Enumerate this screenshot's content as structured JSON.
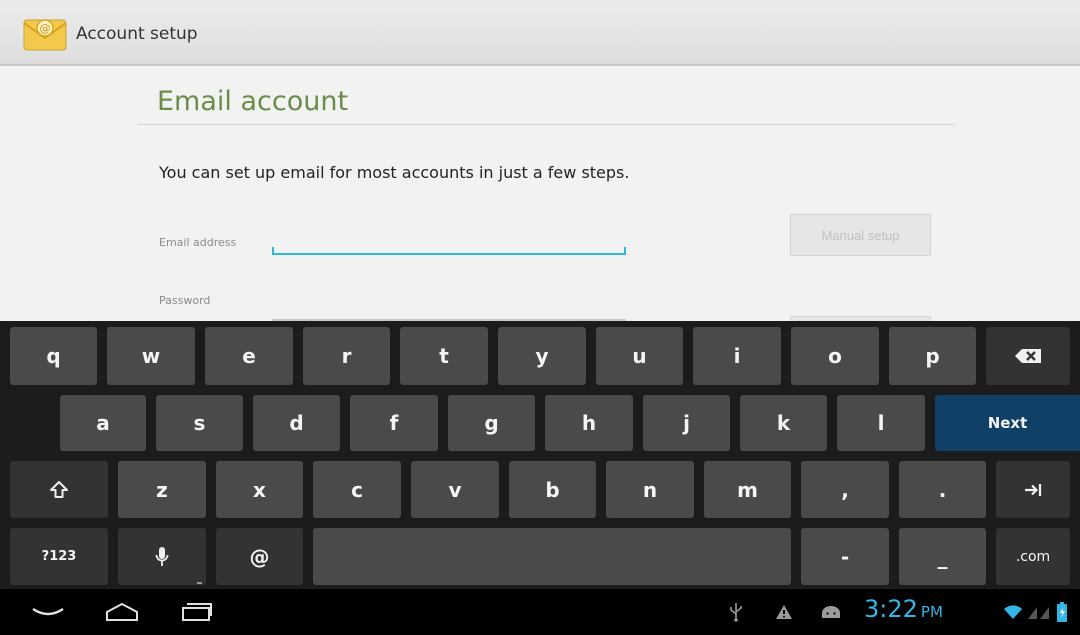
{
  "action_bar": {
    "title": "Account setup",
    "icon": "email-app-icon"
  },
  "form": {
    "heading": "Email account",
    "intro": "You can set up email for most accounts in just a few steps.",
    "email_label": "Email address",
    "email_value": "",
    "password_label": "Password",
    "password_value": "",
    "manual_setup_label": "Manual setup",
    "heading_color": "#6a8d48",
    "focus_color": "#33b5e5"
  },
  "keyboard": {
    "row1": [
      "q",
      "w",
      "e",
      "r",
      "t",
      "y",
      "u",
      "i",
      "o",
      "p"
    ],
    "row2": [
      "a",
      "s",
      "d",
      "f",
      "g",
      "h",
      "j",
      "k",
      "l"
    ],
    "row3": [
      "z",
      "x",
      "c",
      "v",
      "b",
      "n",
      "m",
      ",",
      "."
    ],
    "next_label": "Next",
    "symbols_label": "?123",
    "at_label": "@",
    "dash_label": "-",
    "underscore_label": "_",
    "com_label": ".com",
    "backspace_icon": "backspace-icon",
    "shift_icon": "shift-icon",
    "tab_icon": "tab-icon",
    "mic_icon": "microphone-icon",
    "accent_color": "#114066"
  },
  "navbar": {
    "back_icon": "back-icon",
    "home_icon": "home-icon",
    "recents_icon": "recent-apps-icon"
  },
  "status": {
    "time": "3:22",
    "ampm": "PM",
    "icons": [
      "usb-icon",
      "warning-icon",
      "android-debug-icon",
      "wifi-icon",
      "signal-icon",
      "battery-icon"
    ],
    "clock_color": "#33b5e5"
  }
}
